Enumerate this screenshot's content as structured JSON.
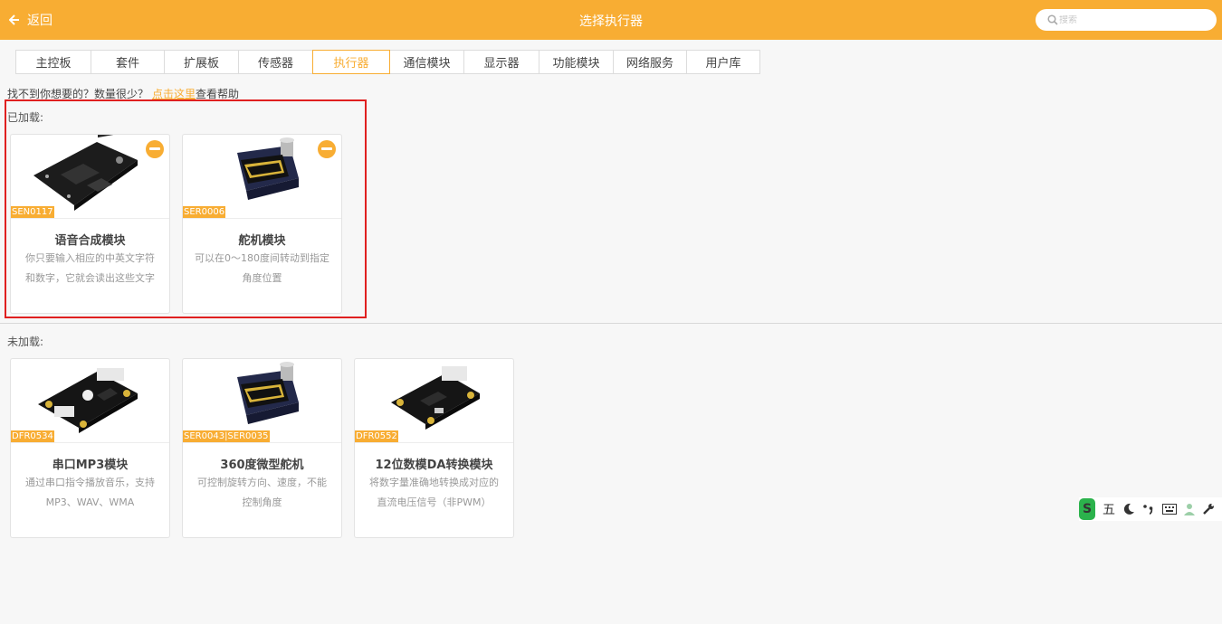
{
  "header": {
    "back_label": "返回",
    "title": "选择执行器",
    "search_placeholder": "搜索"
  },
  "tabs": [
    {
      "label": "主控板",
      "active": false
    },
    {
      "label": "套件",
      "active": false
    },
    {
      "label": "扩展板",
      "active": false
    },
    {
      "label": "传感器",
      "active": false
    },
    {
      "label": "执行器",
      "active": true
    },
    {
      "label": "通信模块",
      "active": false
    },
    {
      "label": "显示器",
      "active": false
    },
    {
      "label": "功能模块",
      "active": false
    },
    {
      "label": "网络服务",
      "active": false
    },
    {
      "label": "用户库",
      "active": false
    }
  ],
  "help": {
    "prefix": "找不到你想要的？数量很少？",
    "link": "点击这里",
    "suffix": "查看帮助"
  },
  "loaded": {
    "label": "已加载:",
    "cards": [
      {
        "sku": "SEN0117",
        "name": "语音合成模块",
        "desc": "你只要输入相应的中英文字符和数字，它就会读出这些文字",
        "image": "tts-board"
      },
      {
        "sku": "SER0006",
        "name": "舵机模块",
        "desc": "可以在0～180度间转动到指定角度位置",
        "image": "servo"
      }
    ]
  },
  "unloaded": {
    "label": "未加载:",
    "cards": [
      {
        "sku": "DFR0534",
        "name": "串口MP3模块",
        "desc": "通过串口指令播放音乐，支持MP3、WAV、WMA",
        "image": "mp3-board"
      },
      {
        "sku": "SER0043|SER0035",
        "name": "360度微型舵机",
        "desc": "可控制旋转方向、速度，不能控制角度",
        "image": "servo"
      },
      {
        "sku": "DFR0552",
        "name": "12位数模DA转换模块",
        "desc": "将数字量准确地转换成对应的直流电压信号（非PWM）",
        "image": "da-board"
      }
    ]
  },
  "ime_toolbar": {
    "logo": "S",
    "mode": "五",
    "items": [
      "moon-icon",
      "punctuation-icon",
      "keyboard-icon",
      "user-icon",
      "wrench-icon"
    ]
  },
  "colors": {
    "accent": "#f8ad33",
    "highlight": "#e02020"
  }
}
